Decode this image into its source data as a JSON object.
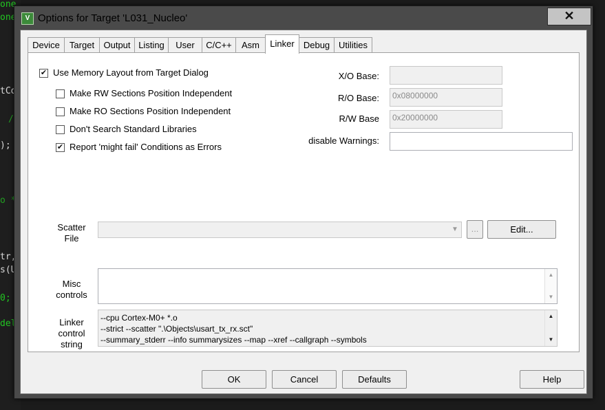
{
  "background_code": {
    "lines": [
      {
        "text": "one",
        "color": "#22c622"
      },
      {
        "text": "one",
        "color": "#22c622"
      },
      {
        "text": "tCo",
        "color": "#d8d8d8"
      },
      {
        "text": "/",
        "color": "#22a022"
      },
      {
        "text": ");",
        "color": "#d8d8d8"
      },
      {
        "text": "o *",
        "color": "#22a022"
      },
      {
        "text": "tr,",
        "color": "#d8d8d8"
      },
      {
        "text": "s(U",
        "color": "#d8d8d8"
      },
      {
        "text": "0;",
        "color": "#22c622"
      },
      {
        "text": "del",
        "color": "#22c622"
      }
    ]
  },
  "window": {
    "title": "Options for Target 'L031_Nucleo'",
    "logo_glyph": "V",
    "close_glyph": "✕"
  },
  "tabs": [
    {
      "label": "Device",
      "active": false
    },
    {
      "label": "Target",
      "active": false
    },
    {
      "label": "Output",
      "active": false
    },
    {
      "label": "Listing",
      "active": false
    },
    {
      "label": "User",
      "active": false
    },
    {
      "label": "C/C++",
      "active": false
    },
    {
      "label": "Asm",
      "active": false
    },
    {
      "label": "Linker",
      "active": true
    },
    {
      "label": "Debug",
      "active": false
    },
    {
      "label": "Utilities",
      "active": false
    }
  ],
  "linker": {
    "checkboxes": [
      {
        "label": "Use Memory Layout from Target Dialog",
        "checked": true
      },
      {
        "label": "Make RW Sections Position Independent",
        "checked": false
      },
      {
        "label": "Make RO Sections Position Independent",
        "checked": false
      },
      {
        "label": "Don't Search Standard Libraries",
        "checked": false
      },
      {
        "label": "Report 'might fail' Conditions as Errors",
        "checked": true
      }
    ],
    "xo_base_label": "X/O Base:",
    "xo_base_value": "",
    "ro_base_label": "R/O Base:",
    "ro_base_value": "0x08000000",
    "rw_base_label": "R/W Base",
    "rw_base_value": "0x20000000",
    "disable_warnings_label": "disable Warnings:",
    "disable_warnings_value": "",
    "scatter_label_1": "Scatter",
    "scatter_label_2": "File",
    "scatter_value": "",
    "browse_label": "...",
    "edit_label": "Edit...",
    "misc_label_1": "Misc",
    "misc_label_2": "controls",
    "misc_value": "",
    "linker_string_label_1": "Linker",
    "linker_string_label_2": "control",
    "linker_string_label_3": "string",
    "linker_string_lines": [
      "--cpu Cortex-M0+ *.o",
      "--strict --scatter \".\\Objects\\usart_tx_rx.sct\"",
      "--summary_stderr --info summarysizes --map --xref --callgraph --symbols"
    ]
  },
  "buttons": {
    "ok": "OK",
    "cancel": "Cancel",
    "defaults": "Defaults",
    "help": "Help"
  },
  "glyphs": {
    "check": "✔",
    "arrow_down": "▼",
    "arrow_up": "▲"
  }
}
